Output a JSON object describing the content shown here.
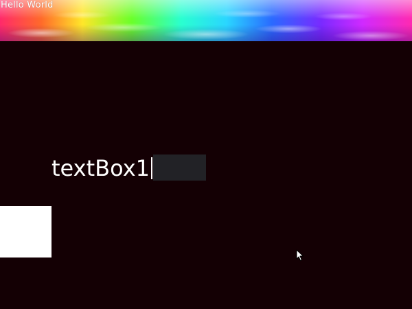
{
  "window": {
    "title": "Hello World"
  },
  "textbox": {
    "value": "textBox1"
  },
  "colors": {
    "background": "#140004",
    "textbox_background": "#222226",
    "block": "#ffffff"
  },
  "icons": {
    "cursor": "mouse-pointer-icon"
  }
}
